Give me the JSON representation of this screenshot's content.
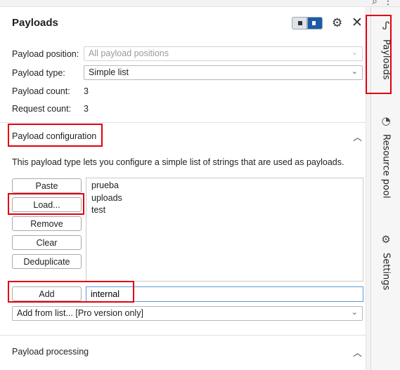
{
  "top_icons": [
    "search-icon",
    "more-icon"
  ],
  "header": {
    "title": "Payloads"
  },
  "fields": {
    "position_label": "Payload position:",
    "position_value": "All payload positions",
    "type_label": "Payload type:",
    "type_value": "Simple list",
    "count_label": "Payload count:",
    "count_value": "3",
    "request_label": "Request count:",
    "request_value": "3"
  },
  "config": {
    "title": "Payload configuration",
    "description": "This payload type lets you configure a simple list of strings that are used as payloads.",
    "buttons": {
      "paste": "Paste",
      "load": "Load...",
      "remove": "Remove",
      "clear": "Clear",
      "deduplicate": "Deduplicate",
      "add": "Add"
    },
    "items": [
      "prueba",
      "uploads",
      "test"
    ],
    "add_value": "internal",
    "add_from_list": "Add from list... [Pro version only]"
  },
  "processing": {
    "title": "Payload processing"
  },
  "sidebar": {
    "tabs": [
      "Payloads",
      "Resource pool",
      "Settings"
    ]
  },
  "colors": {
    "accent": "#1e5aa8",
    "highlight": "#e0000f",
    "input_focus": "#5b9bd5"
  }
}
